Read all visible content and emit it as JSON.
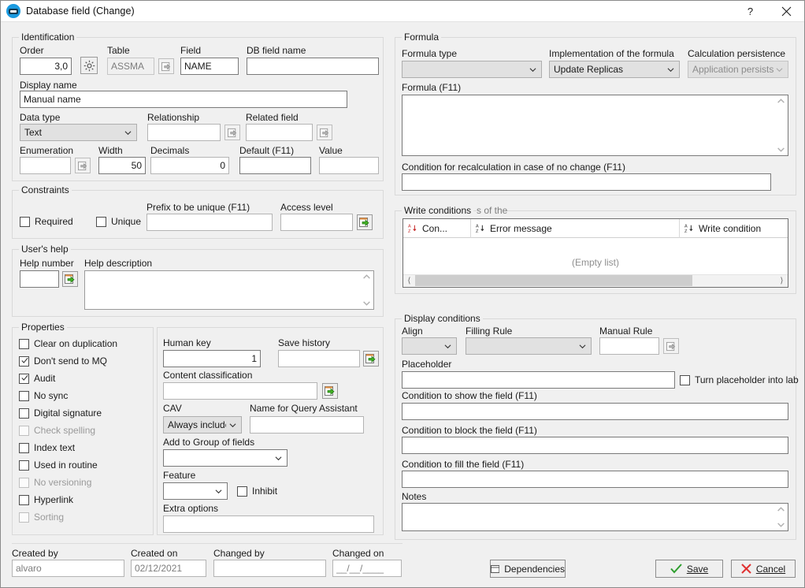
{
  "window": {
    "title": "Database field (Change)",
    "icon": "bot-icon",
    "help_button": "?",
    "close_button": "✕"
  },
  "identification": {
    "legend": "Identification",
    "order_label": "Order",
    "order_value": "3,0",
    "gear_icon": "gear-icon",
    "table_label": "Table",
    "table_value": "ASSMA",
    "field_label": "Field",
    "field_value": "NAME",
    "db_field_name_label": "DB field name",
    "db_field_name_value": "",
    "display_name_label": "Display name",
    "display_name_value": "Manual name",
    "data_type_label": "Data type",
    "data_type_value": "Text",
    "relationship_label": "Relationship",
    "relationship_value": "",
    "related_field_label": "Related field",
    "related_field_value": "",
    "enumeration_label": "Enumeration",
    "enumeration_value": "",
    "width_label": "Width",
    "width_value": "50",
    "decimals_label": "Decimals",
    "decimals_value": "0",
    "default_label": "Default (F11)",
    "default_value": "",
    "value_label": "Value",
    "value_value": ""
  },
  "constraints": {
    "legend": "Constraints",
    "required_label": "Required",
    "required_checked": false,
    "unique_label": "Unique",
    "unique_checked": false,
    "prefix_label": "Prefix to be unique (F11)",
    "prefix_value": "",
    "access_level_label": "Access level",
    "access_level_value": ""
  },
  "users_help": {
    "legend": "User's help",
    "help_number_label": "Help number",
    "help_number_value": "",
    "help_description_label": "Help description",
    "help_description_value": ""
  },
  "properties": {
    "legend": "Properties",
    "checkboxes": [
      {
        "label": "Clear on duplication",
        "checked": false,
        "disabled": false
      },
      {
        "label": "Don't send to MQ",
        "checked": true,
        "disabled": false
      },
      {
        "label": "Audit",
        "checked": true,
        "disabled": false
      },
      {
        "label": "No sync",
        "checked": false,
        "disabled": false
      },
      {
        "label": "Digital signature",
        "checked": false,
        "disabled": false
      },
      {
        "label": "Check spelling",
        "checked": false,
        "disabled": true
      },
      {
        "label": "Index text",
        "checked": false,
        "disabled": false
      },
      {
        "label": "Used in routine",
        "checked": false,
        "disabled": false
      },
      {
        "label": "No versioning",
        "checked": false,
        "disabled": true
      },
      {
        "label": "Hyperlink",
        "checked": false,
        "disabled": false
      },
      {
        "label": "Sorting",
        "checked": false,
        "disabled": true
      }
    ],
    "human_key_label": "Human key",
    "human_key_value": "1",
    "save_history_label": "Save history",
    "save_history_value": "",
    "content_classification_label": "Content classification",
    "content_classification_value": "",
    "cav_label": "CAV",
    "cav_value": "Always included",
    "query_assistant_label": "Name for Query Assistant",
    "query_assistant_value": "",
    "group_of_fields_label": "Add to Group of fields",
    "group_of_fields_value": "",
    "feature_label": "Feature",
    "feature_value": "",
    "inhibit_label": "Inhibit",
    "inhibit_checked": false,
    "extra_options_label": "Extra options",
    "extra_options_value": ""
  },
  "formula": {
    "legend": "Formula",
    "formula_type_label": "Formula type",
    "formula_type_value": "",
    "implementation_label": "Implementation of the formula",
    "implementation_value": "Update Replicas",
    "calculation_persistence_label": "Calculation persistence",
    "calculation_persistence_value": "Application persists",
    "formula_field_label": "Formula (F11)",
    "formula_field_value": "",
    "recalc_condition_label": "Condition for recalculation in case of no change (F11)",
    "recalc_condition_value": ""
  },
  "write_conditions": {
    "legend": "Write conditions",
    "legend_overlap": "s of the",
    "columns": [
      {
        "sort_icon": "sort-az-icon",
        "label": "Con..."
      },
      {
        "sort_icon": "sort-az-icon",
        "label": "Error message"
      },
      {
        "sort_icon": "sort-az-icon",
        "label": "Write condition"
      }
    ],
    "empty_text": "(Empty list)"
  },
  "display_conditions": {
    "legend": "Display conditions",
    "align_label": "Align",
    "align_value": "",
    "filling_rule_label": "Filling Rule",
    "filling_rule_value": "",
    "manual_rule_label": "Manual Rule",
    "manual_rule_value": "",
    "placeholder_label": "Placeholder",
    "placeholder_value": "",
    "turn_placeholder_label": "Turn placeholder into lab",
    "turn_placeholder_checked": false,
    "condition_show_label": "Condition to show the field (F11)",
    "condition_show_value": "",
    "condition_block_label": "Condition to block the field (F11)",
    "condition_block_value": "",
    "condition_fill_label": "Condition to fill the field (F11)",
    "condition_fill_value": "",
    "notes_label": "Notes",
    "notes_value": ""
  },
  "footer": {
    "created_by_label": "Created by",
    "created_by_value": "alvaro",
    "created_on_label": "Created on",
    "created_on_value": "02/12/2021",
    "changed_by_label": "Changed by",
    "changed_by_value": "",
    "changed_on_label": "Changed on",
    "changed_on_value": "__/__/____",
    "dependencies_button": "Dependencies",
    "save_button": "Save",
    "cancel_button": "Cancel"
  },
  "colors": {
    "accent_blue": "#1a9ae0",
    "green_check": "#2e9e2e",
    "red_x": "#e03131",
    "window_bg": "#f0f0f0"
  }
}
